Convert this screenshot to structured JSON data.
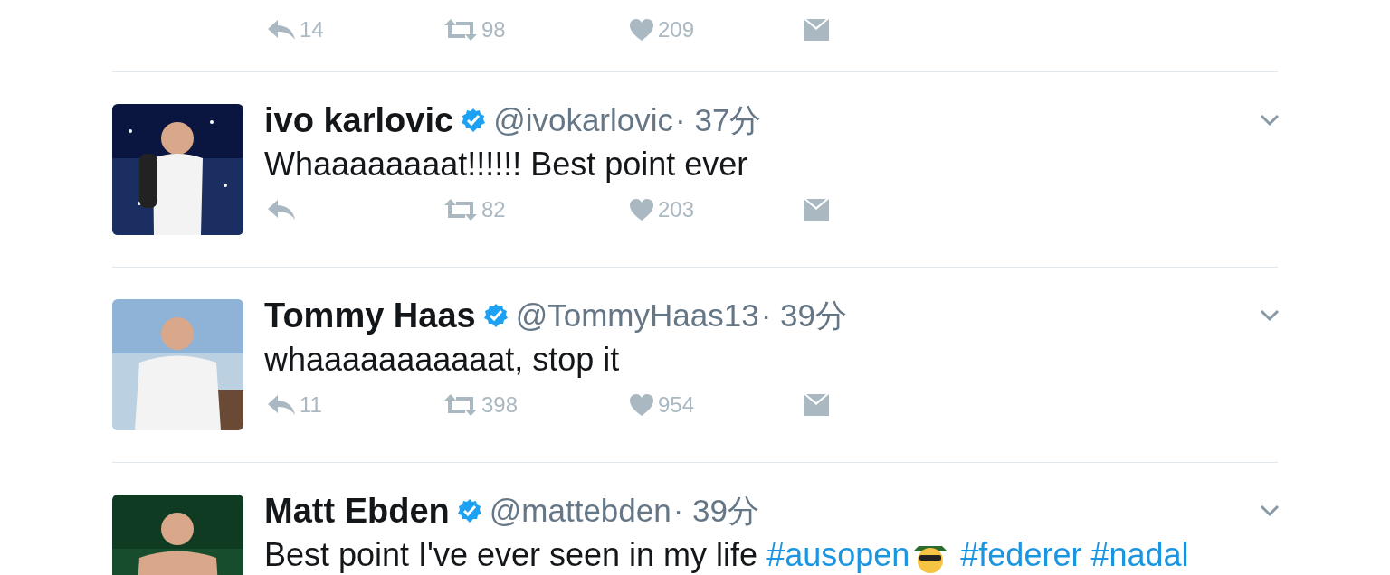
{
  "top_actions": {
    "reply": "14",
    "retweet": "98",
    "like": "209"
  },
  "tweets": [
    {
      "name": "ivo karlovic",
      "verified": true,
      "handle": "@ivokarlovic",
      "time": "· 37分",
      "text": [
        {
          "kind": "plain",
          "text": "Whaaaaaaaat!!!!!! Best point ever"
        }
      ],
      "retweet": "82",
      "like": "203"
    },
    {
      "name": "Tommy Haas",
      "verified": true,
      "handle": "@TommyHaas13",
      "time": "· 39分",
      "text": [
        {
          "kind": "plain",
          "text": "whaaaaaaaaaaat, stop it"
        }
      ],
      "reply": "11",
      "retweet": "398",
      "like": "954"
    },
    {
      "name": "Matt Ebden",
      "verified": true,
      "handle": "@mattebden",
      "time": "· 39分",
      "text": [
        {
          "kind": "plain",
          "text": "Best point I've ever seen in my life"
        },
        {
          "kind": "space"
        },
        {
          "kind": "hashtag",
          "text": "#ausopen"
        },
        {
          "kind": "emoji"
        },
        {
          "kind": "space"
        },
        {
          "kind": "hashtag",
          "text": "#federer"
        },
        {
          "kind": "space"
        },
        {
          "kind": "hashtag",
          "text": "#nadal"
        }
      ]
    }
  ]
}
